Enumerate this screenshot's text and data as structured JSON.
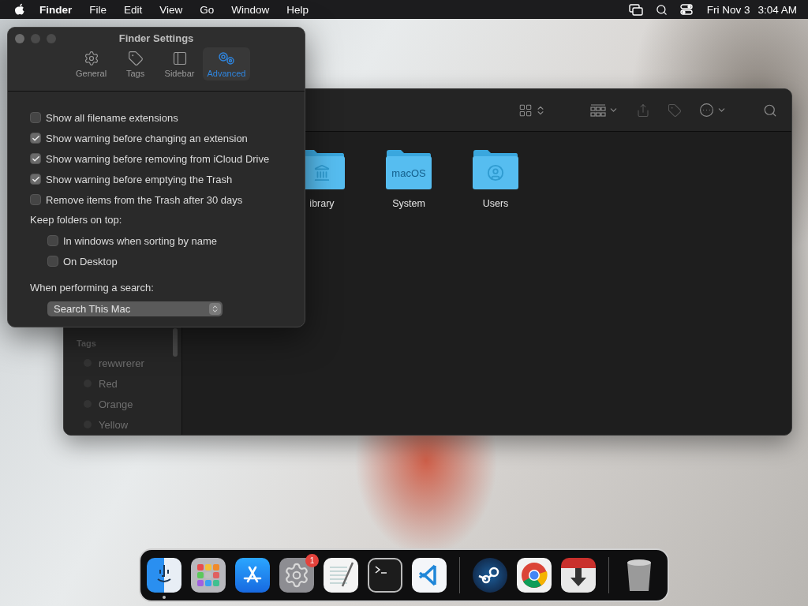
{
  "menu_bar": {
    "app_name": "Finder",
    "menus": [
      "File",
      "Edit",
      "View",
      "Go",
      "Window",
      "Help"
    ],
    "date": "Fri Nov 3",
    "time": "3:04 AM"
  },
  "finder_window": {
    "sidebar": {
      "section": "Tags",
      "tags": [
        "rewwrerer",
        "Red",
        "Orange",
        "Yellow"
      ]
    },
    "folders": [
      {
        "kind": "library",
        "label": "ibrary"
      },
      {
        "kind": "system",
        "label": "System",
        "badge": "macOS"
      },
      {
        "kind": "users",
        "label": "Users"
      }
    ]
  },
  "settings_window": {
    "title": "Finder Settings",
    "tabs": [
      {
        "kind": "general",
        "label": "General",
        "selected": false
      },
      {
        "kind": "tags",
        "label": "Tags",
        "selected": false
      },
      {
        "kind": "sidebar",
        "label": "Sidebar",
        "selected": false
      },
      {
        "kind": "advanced",
        "label": "Advanced",
        "selected": true
      }
    ],
    "options": [
      {
        "label": "Show all filename extensions",
        "checked": false
      },
      {
        "label": "Show warning before changing an extension",
        "checked": true
      },
      {
        "label": "Show warning before removing from iCloud Drive",
        "checked": true
      },
      {
        "label": "Show warning before emptying the Trash",
        "checked": true
      },
      {
        "label": "Remove items from the Trash after 30 days",
        "checked": false
      }
    ],
    "keep_folders": {
      "label": "Keep folders on top:",
      "options": [
        {
          "label": "In windows when sorting by name",
          "checked": false
        },
        {
          "label": "On Desktop",
          "checked": false
        }
      ]
    },
    "search": {
      "label": "When performing a search:",
      "value": "Search This Mac"
    }
  },
  "dock": {
    "apps": [
      {
        "kind": "finder",
        "running": true
      },
      {
        "kind": "launchpad",
        "running": false
      },
      {
        "kind": "appstore",
        "running": false
      },
      {
        "kind": "settings",
        "running": false,
        "badge": "1"
      },
      {
        "kind": "textedit",
        "running": false
      },
      {
        "kind": "terminal",
        "running": false
      },
      {
        "kind": "vscode",
        "running": false
      },
      {
        "kind": "separator"
      },
      {
        "kind": "steam",
        "running": false
      },
      {
        "kind": "chrome",
        "running": false
      },
      {
        "kind": "downloader",
        "running": false
      },
      {
        "kind": "separator"
      },
      {
        "kind": "trash",
        "running": false
      }
    ]
  }
}
